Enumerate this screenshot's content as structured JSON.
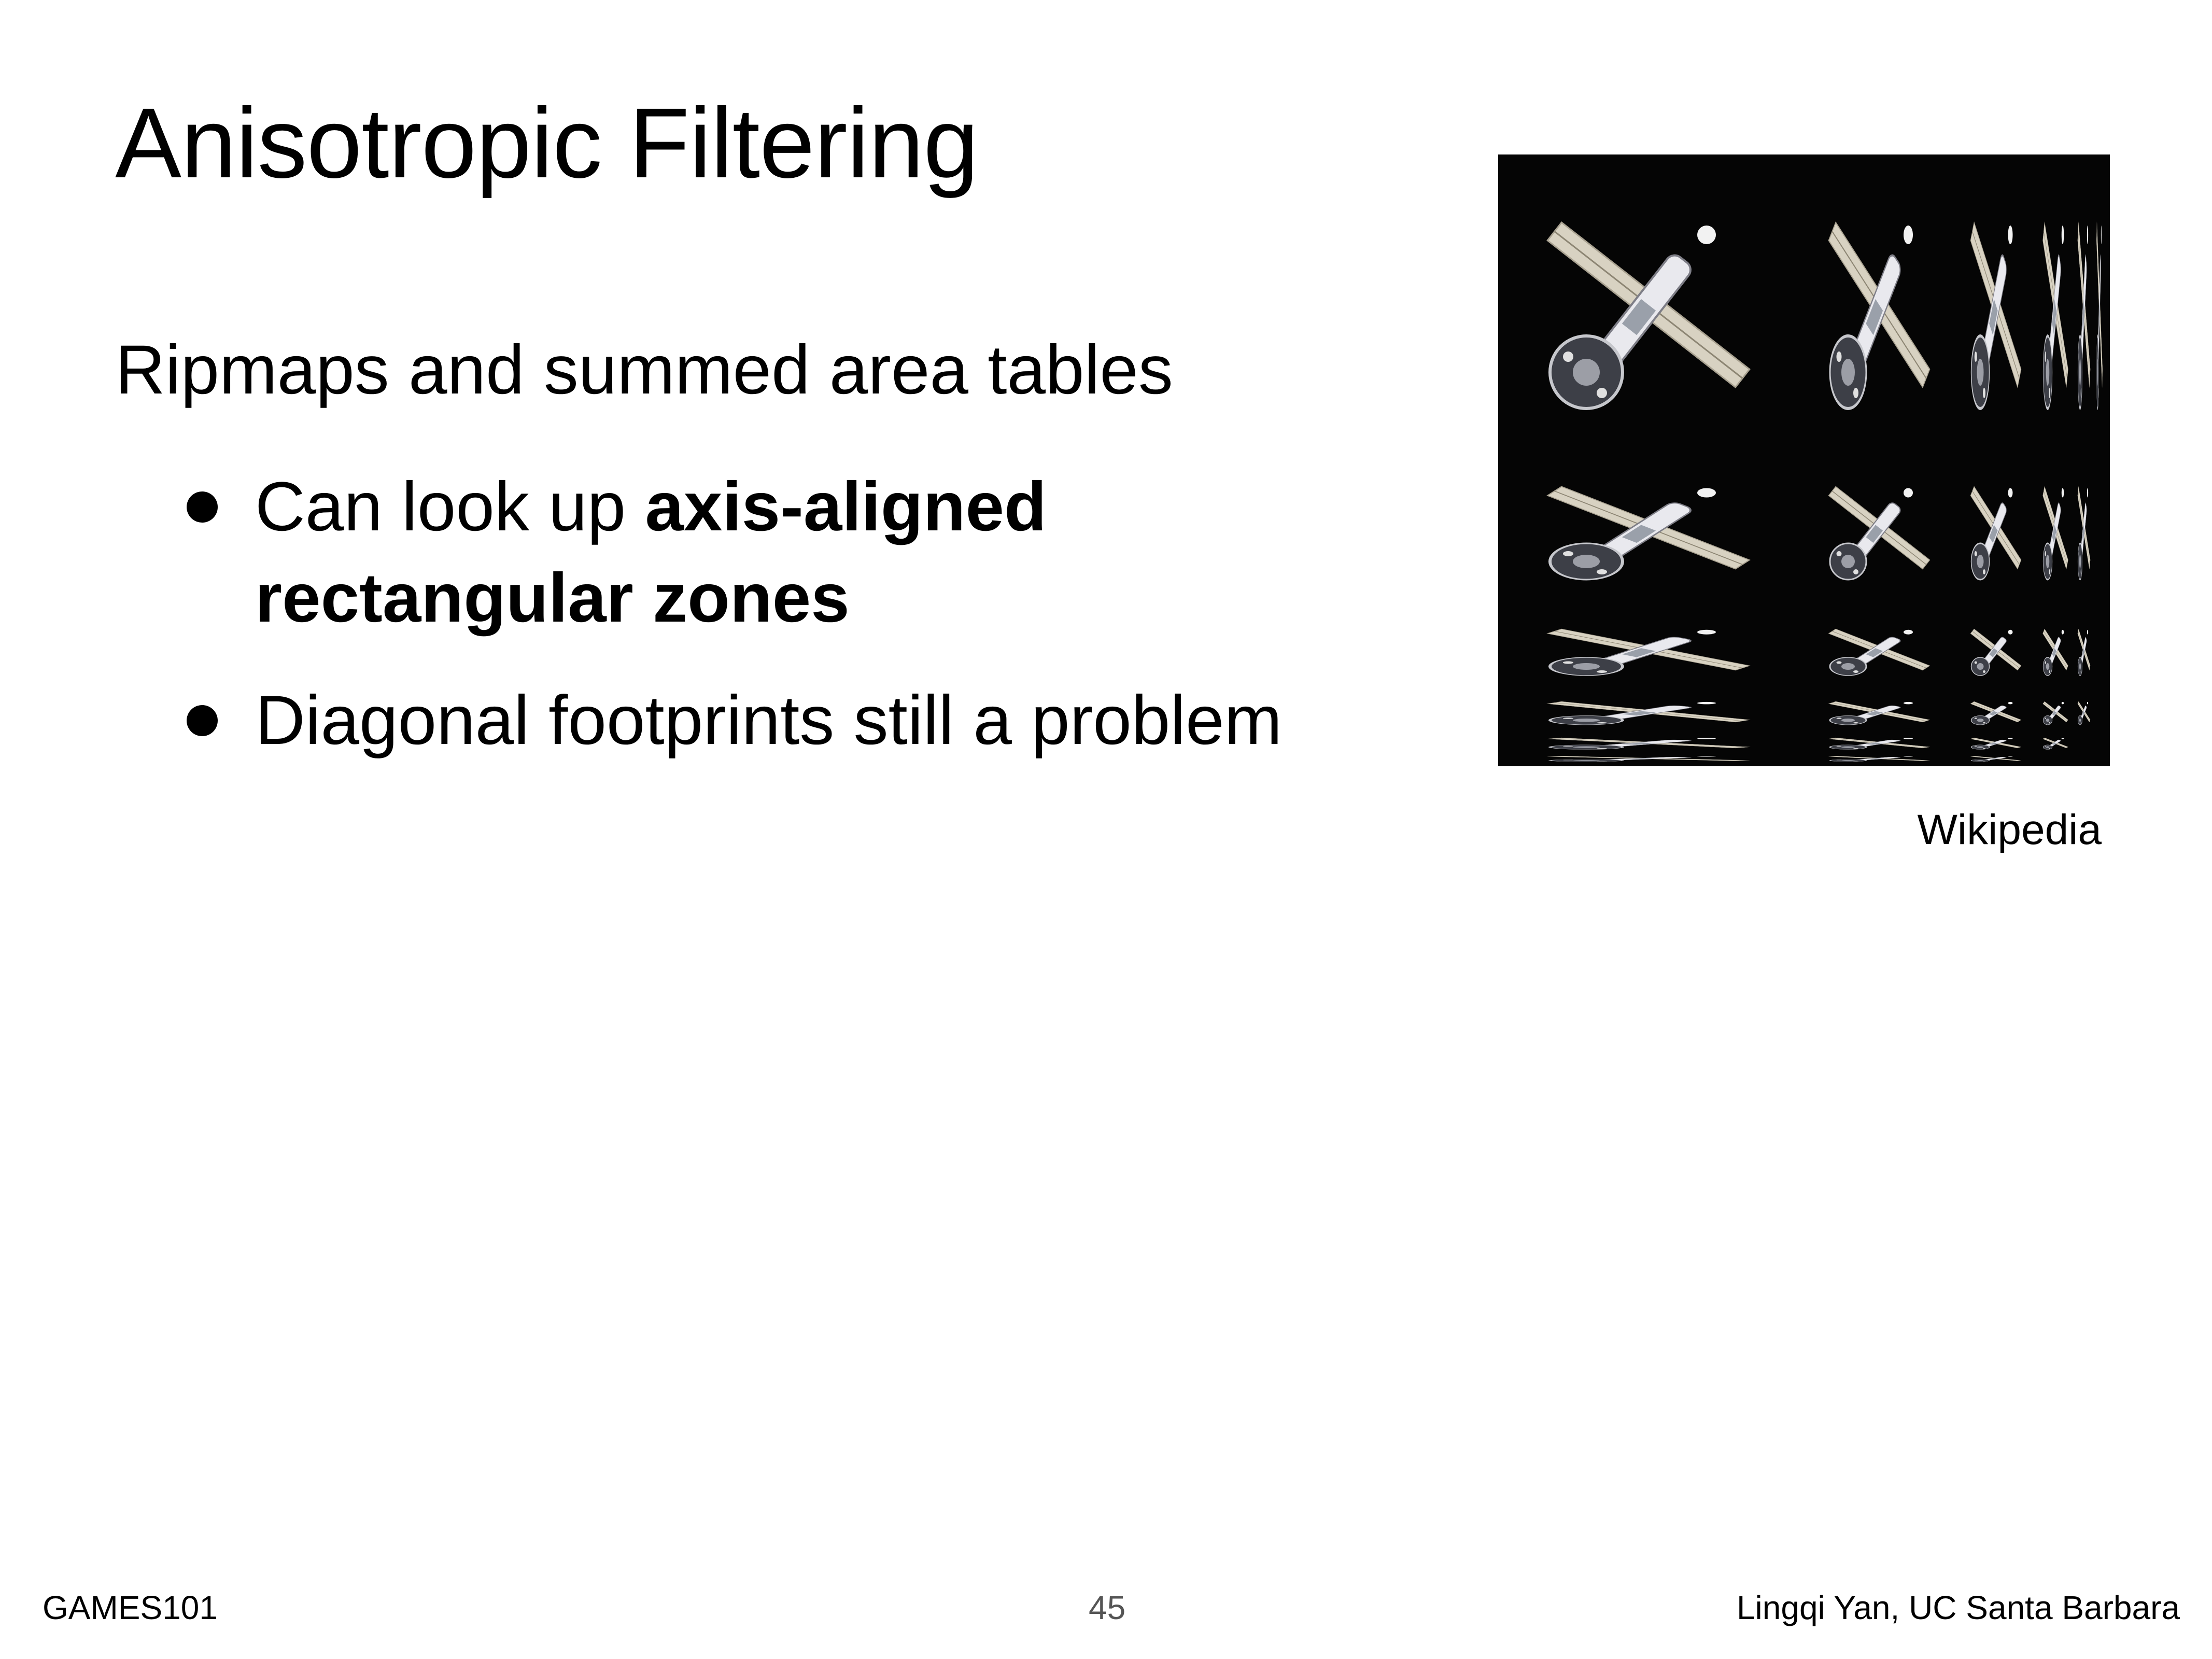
{
  "slide": {
    "title": "Anisotropic Filtering",
    "lead": "Ripmaps and summed area tables",
    "bullets": [
      {
        "text_before": "Can look up ",
        "text_bold": "axis-aligned rectangular zones"
      },
      {
        "text": "Diagonal footprints still a problem"
      }
    ],
    "figure": {
      "description_icon": "ripmap-satellite-image",
      "caption": "Wikipedia"
    }
  },
  "footer": {
    "course": "GAMES101",
    "page_number": "45",
    "author": "Lingqi Yan, UC Santa Barbara"
  }
}
